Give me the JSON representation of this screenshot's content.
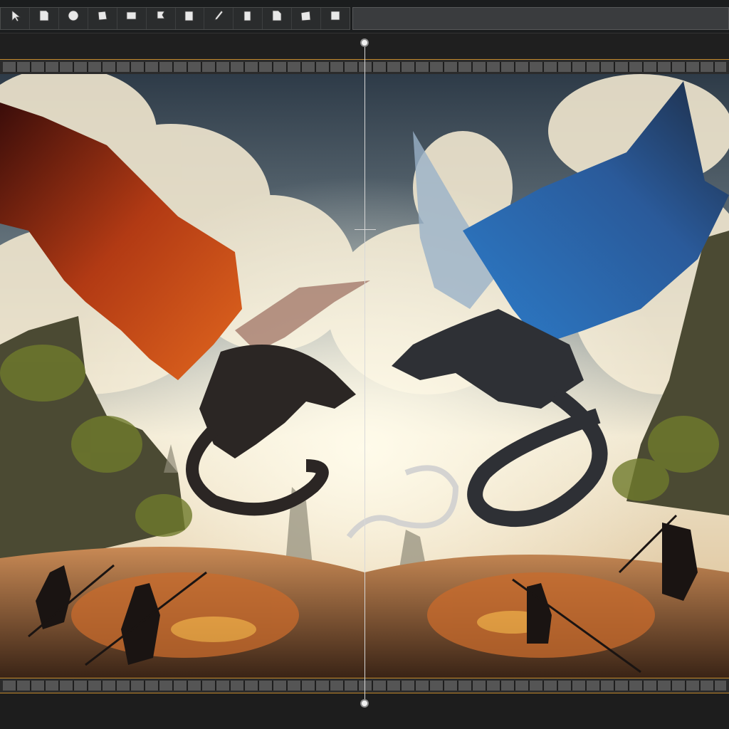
{
  "toolbar": {
    "tools": [
      {
        "label": "",
        "icon": "cursor-icon"
      },
      {
        "label": "",
        "icon": "page-icon"
      },
      {
        "label": "",
        "icon": "globe-icon"
      },
      {
        "label": "",
        "icon": "crop-icon"
      },
      {
        "label": "",
        "icon": "card-icon"
      },
      {
        "label": "",
        "icon": "flag-icon"
      },
      {
        "label": "",
        "icon": "layout-icon"
      },
      {
        "label": "",
        "icon": "brush-icon"
      },
      {
        "label": "",
        "icon": "rectangle-icon"
      },
      {
        "label": "",
        "icon": "page-corner-icon"
      },
      {
        "label": "",
        "icon": "crop-tool-icon"
      },
      {
        "label": "",
        "icon": "grid-icon"
      }
    ]
  },
  "title_field": {
    "value": ""
  },
  "ruler": {
    "marks": [
      "",
      "",
      "",
      "",
      "",
      "",
      "",
      "",
      "",
      "",
      ""
    ]
  },
  "canvas": {
    "description_icon": "image-preview"
  },
  "colors": {
    "accent": "#c48a2c",
    "playhead": "#d8d8d8"
  }
}
